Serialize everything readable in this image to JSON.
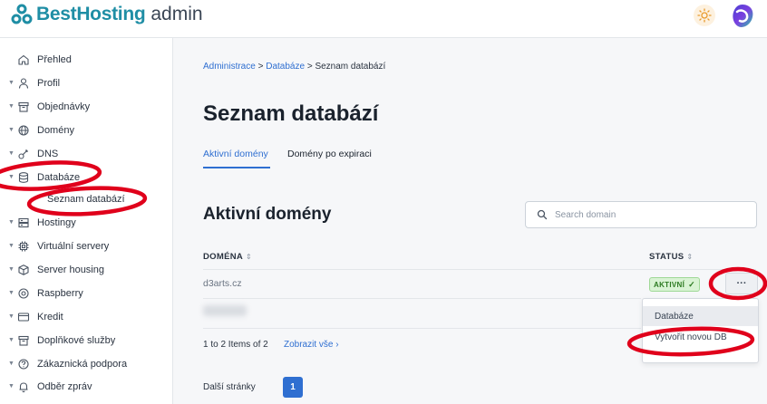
{
  "app": {
    "brand": "BestHosting",
    "suffix": "admin"
  },
  "colors": {
    "brand": "#1f8ea5",
    "accent": "#2f6fd1",
    "annotation": "#e0001b",
    "success": "#2c7a21"
  },
  "sidebar": {
    "items": [
      {
        "label": "Přehled",
        "icon": "home-icon",
        "chevron": false
      },
      {
        "label": "Profil",
        "icon": "user-icon",
        "chevron": true
      },
      {
        "label": "Objednávky",
        "icon": "box-icon",
        "chevron": true
      },
      {
        "label": "Domény",
        "icon": "globe-icon",
        "chevron": true
      },
      {
        "label": "DNS",
        "icon": "dns-icon",
        "chevron": true
      },
      {
        "label": "Databáze",
        "icon": "database-icon",
        "chevron": true,
        "expanded": true
      },
      {
        "label": "Hostingy",
        "icon": "server-icon",
        "chevron": true
      },
      {
        "label": "Virtuální servery",
        "icon": "chip-icon",
        "chevron": true
      },
      {
        "label": "Server housing",
        "icon": "cube-icon",
        "chevron": true
      },
      {
        "label": "Raspberry",
        "icon": "target-icon",
        "chevron": true
      },
      {
        "label": "Kredit",
        "icon": "card-icon",
        "chevron": true
      },
      {
        "label": "Doplňkové služby",
        "icon": "box-icon",
        "chevron": true
      },
      {
        "label": "Zákaznická podpora",
        "icon": "help-icon",
        "chevron": true
      },
      {
        "label": "Odběr zpráv",
        "icon": "bell-icon",
        "chevron": true
      }
    ],
    "subitem": "Seznam databází"
  },
  "breadcrumb": {
    "items": [
      "Administrace",
      "Databáze"
    ],
    "separator": ">",
    "current": "Seznam databází"
  },
  "page": {
    "title": "Seznam databází"
  },
  "tabs": [
    {
      "label": "Aktivní domény",
      "active": true
    },
    {
      "label": "Domény po expiraci",
      "active": false
    }
  ],
  "section": {
    "title": "Aktivní domény"
  },
  "search": {
    "placeholder": "Search domain",
    "value": ""
  },
  "table": {
    "columns": [
      "DOMÉNA",
      "STATUS"
    ],
    "sort_glyph": "⇕",
    "rows": [
      {
        "domain": "d3arts.cz",
        "status": "AKTIVNÍ"
      }
    ]
  },
  "row_menu": {
    "button": "···",
    "items": [
      "Databáze",
      "Vytvořit novou DB"
    ]
  },
  "pagination": {
    "info": "1 to 2 Items of 2",
    "show_all": "Zobrazit vše",
    "next_pages_label": "Další stránky",
    "current_page": "1"
  }
}
